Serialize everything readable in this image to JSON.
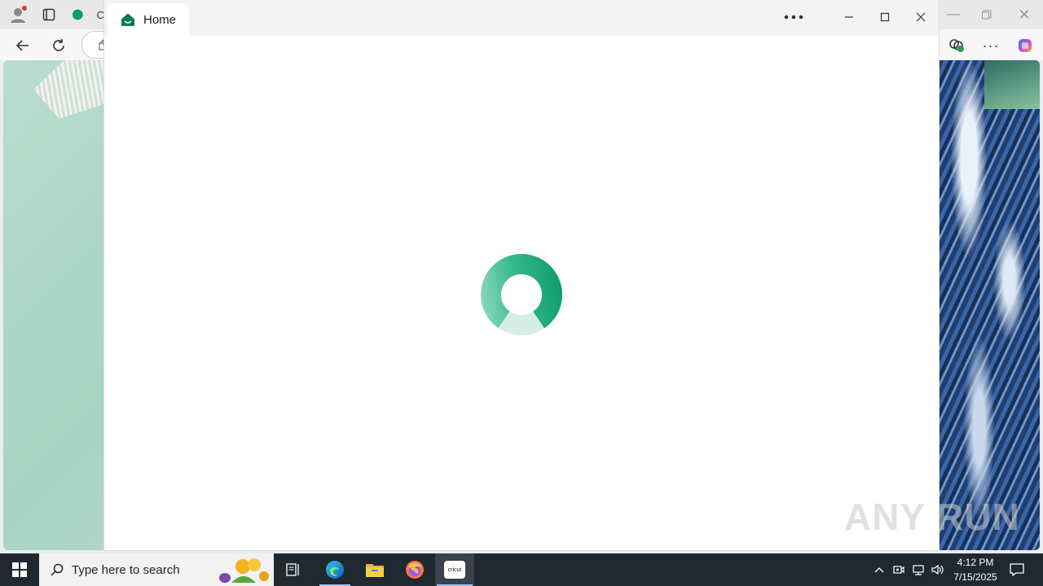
{
  "browser": {
    "tab_partial_label": "C",
    "icons": [
      "profile-icon",
      "tab-actions-icon",
      "back-icon",
      "refresh-icon",
      "share-icon",
      "extensions-icon",
      "more-icon",
      "copilot-icon"
    ]
  },
  "app": {
    "tab_label": "Home",
    "icons": {
      "home": "home-icon",
      "more": "more-horizontal-icon",
      "minimize": "minimize-icon",
      "maximize": "maximize-icon",
      "close": "close-icon"
    },
    "loading": true,
    "accent": "#0d9b6e"
  },
  "taskbar": {
    "search_placeholder": "Type here to search",
    "time": "4:12 PM",
    "date": "7/15/2025",
    "app_label": "cricut"
  },
  "watermark": "ANY RUN"
}
